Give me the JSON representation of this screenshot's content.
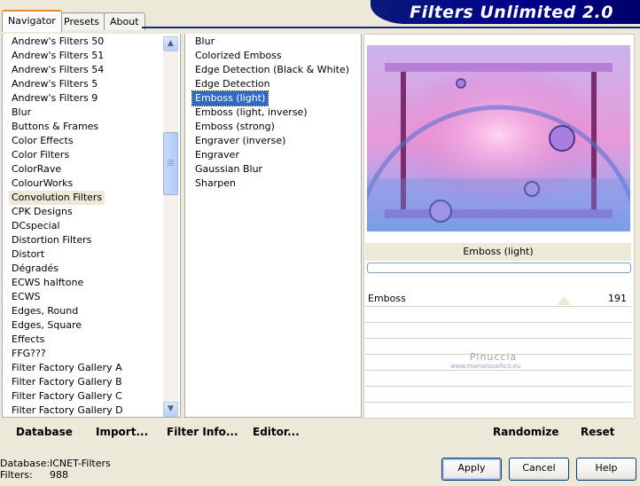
{
  "tabs": [
    "Navigator",
    "Presets",
    "About"
  ],
  "banner_title": "Filters Unlimited 2.0",
  "categories": [
    "Andrew's Filters 50",
    "Andrew's Filters 51",
    "Andrew's Filters 54",
    "Andrew's Filters 5",
    "Andrew's Filters 9",
    "Blur",
    "Buttons & Frames",
    "Color Effects",
    "Color Filters",
    "ColorRave",
    "ColourWorks",
    "Convolution Filters",
    "CPK Designs",
    "DCspecial",
    "Distortion Filters",
    "Distort",
    "Dégradés",
    "ECWS halftone",
    "ECWS",
    "Edges, Round",
    "Edges, Square",
    "Effects",
    "FFG???",
    "Filter Factory Gallery A",
    "Filter Factory Gallery B",
    "Filter Factory Gallery C",
    "Filter Factory Gallery D"
  ],
  "selected_category": "Convolution Filters",
  "filters": [
    "Blur",
    "Colorized Emboss",
    "Edge Detection (Black & White)",
    "Edge Detection",
    "Emboss (light)",
    "Emboss (light, inverse)",
    "Emboss (strong)",
    "Engraver (inverse)",
    "Engraver",
    "Gaussian Blur",
    "Sharpen"
  ],
  "selected_filter": "Emboss (light)",
  "preview_caption": "Emboss (light)",
  "parameter": {
    "name": "Emboss",
    "value": "191"
  },
  "watermark": {
    "line1": "Pinuccia",
    "line2": "www.mariarosaifico.eu"
  },
  "toolbar": {
    "database": "Database",
    "import": "Import...",
    "filter_info": "Filter Info...",
    "editor": "Editor...",
    "randomize": "Randomize",
    "reset": "Reset"
  },
  "status": {
    "database_label": "Database:",
    "database_value": "ICNET-Filters",
    "filters_label": "Filters:",
    "filters_value": "988"
  },
  "buttons": {
    "apply": "Apply",
    "cancel": "Cancel",
    "help": "Help"
  }
}
